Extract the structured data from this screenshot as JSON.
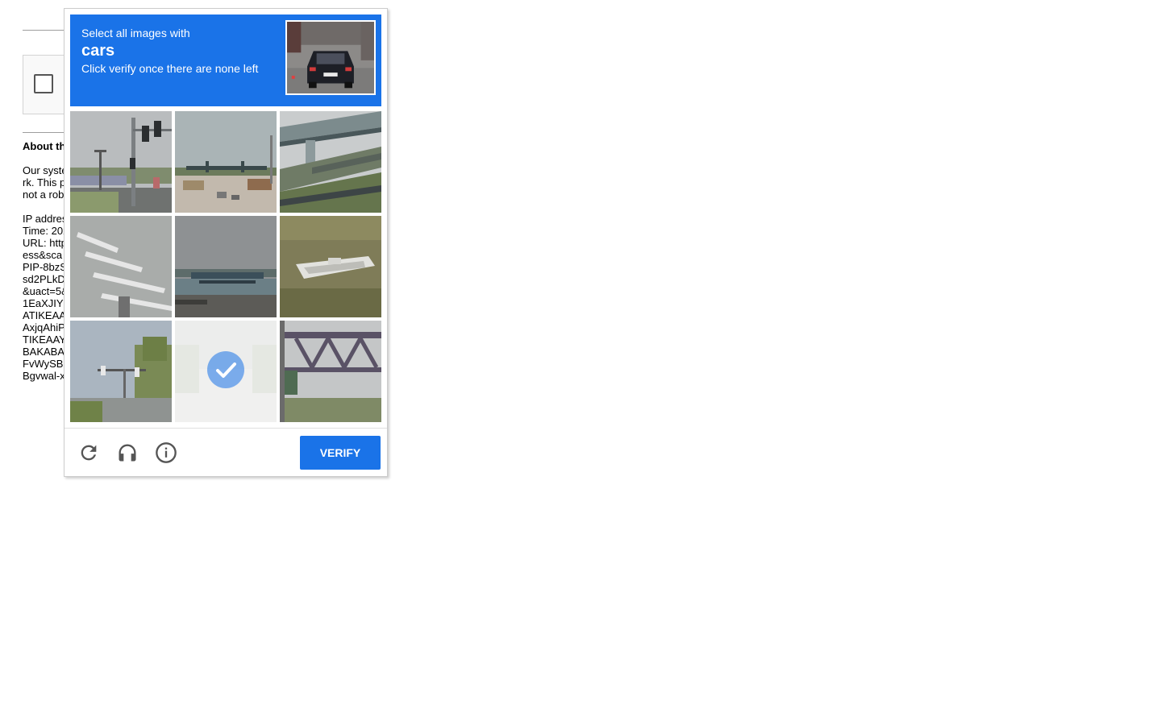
{
  "background_page": {
    "heading": "About th",
    "body_lines": [
      "Our syste",
      "rk. This p",
      "not a rob"
    ],
    "details_lines": [
      "IP addres",
      "Time: 202",
      "URL: http",
      "ess&sca",
      "PIP-8bzS",
      "sd2PLkD",
      "&uact=5&",
      "1EaXJIY",
      "ATIKEAA",
      "AxjqAhiP",
      "TIKEAAY",
      "BAKABA",
      "FvWySB",
      "Bgvwal-x"
    ]
  },
  "challenge": {
    "instruction": "Select all images with",
    "target": "cars",
    "subinstruction": "Click verify once there are none left",
    "tiles": [
      {
        "name": "tile-traffic-lights",
        "selected": false
      },
      {
        "name": "tile-road-horizon",
        "selected": false
      },
      {
        "name": "tile-overpass",
        "selected": false
      },
      {
        "name": "tile-crosswalk",
        "selected": false
      },
      {
        "name": "tile-shoreline",
        "selected": false
      },
      {
        "name": "tile-boat",
        "selected": false
      },
      {
        "name": "tile-street-signals",
        "selected": false
      },
      {
        "name": "tile-street-faded",
        "selected": true
      },
      {
        "name": "tile-bridge-truss",
        "selected": false
      }
    ],
    "verify_label": "VERIFY",
    "icons": {
      "reload": "reload-icon",
      "audio": "headphones-icon",
      "info": "info-icon"
    },
    "colors": {
      "accent": "#1a73e8",
      "icon": "#555555"
    }
  }
}
